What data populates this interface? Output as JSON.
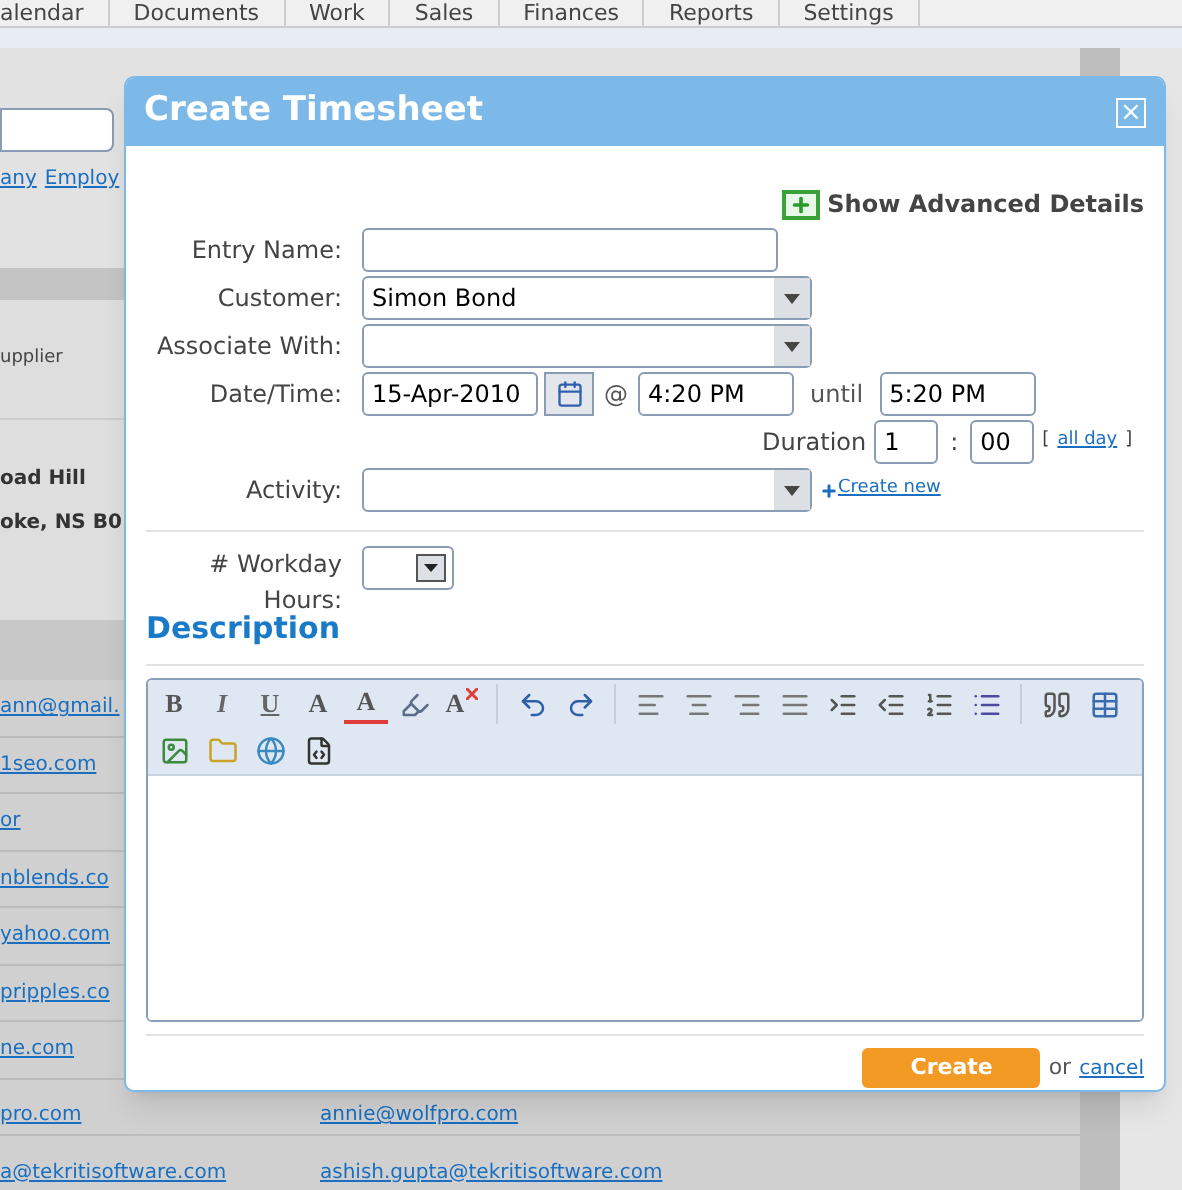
{
  "nav_tabs": [
    {
      "label": "alendar"
    },
    {
      "label": "Documents"
    },
    {
      "label": "Work"
    },
    {
      "label": "Sales"
    },
    {
      "label": "Finances"
    },
    {
      "label": "Reports"
    },
    {
      "label": "Settings"
    }
  ],
  "background": {
    "links": [
      "any",
      "Employ"
    ],
    "supplier": "upplier",
    "address": [
      "oad Hill",
      "oke, NS B0"
    ],
    "emails": [
      "ann@gmail.",
      "1seo.com",
      "or",
      "nblends.co",
      "yahoo.com",
      "pripples.co",
      "ne.com",
      "pro.com",
      "a@tekritisoftware.com"
    ],
    "emails_2": [
      "annie@wolfpro.com",
      "ashish.gupta@tekritisoftware.com"
    ]
  },
  "dialog": {
    "title": "Create Timesheet",
    "close": "×",
    "advanced_link": "Show Advanced Details",
    "entry_name": {
      "label": "Entry Name:"
    },
    "customer": {
      "label": "Customer:",
      "value": "Simon Bond"
    },
    "associate_with": {
      "label": "Associate With:"
    },
    "date_time": {
      "label": "Date/Time:",
      "date": "15-Apr-2010",
      "at": "@",
      "start": "4:20 PM",
      "until": "until",
      "end": "5:20 PM"
    },
    "duration": {
      "label": "Duration",
      "hours": "1",
      "separator": ":",
      "minutes": "00",
      "open": "[",
      "all_day": "all day",
      "close": "]"
    },
    "activity": {
      "label": "Activity:",
      "create_new": "Create new"
    },
    "workday_hours": {
      "label": "# Workday Hours:"
    },
    "description_heading": "Description",
    "toolbar_rows": [
      [
        {
          "kind": "bold",
          "label": "B"
        },
        {
          "kind": "italic",
          "label": "I"
        },
        {
          "kind": "underline",
          "label": "U"
        },
        {
          "kind": "font-size",
          "label": "A"
        },
        {
          "kind": "font-color",
          "label": "A"
        },
        {
          "kind": "highlight"
        },
        {
          "kind": "clear-format",
          "label": "A"
        },
        {
          "kind": "separator"
        },
        {
          "kind": "undo"
        },
        {
          "kind": "redo"
        },
        {
          "kind": "separator"
        },
        {
          "kind": "align-left"
        },
        {
          "kind": "align-center"
        },
        {
          "kind": "align-right"
        },
        {
          "kind": "justify"
        },
        {
          "kind": "indent"
        },
        {
          "kind": "outdent"
        },
        {
          "kind": "ordered-list"
        },
        {
          "kind": "bullet-list"
        },
        {
          "kind": "separator"
        },
        {
          "kind": "quote"
        },
        {
          "kind": "table"
        }
      ],
      [
        {
          "kind": "image"
        },
        {
          "kind": "folder"
        },
        {
          "kind": "globe"
        },
        {
          "kind": "code"
        }
      ]
    ],
    "create_button": "Create",
    "or": "or",
    "cancel": "cancel"
  }
}
